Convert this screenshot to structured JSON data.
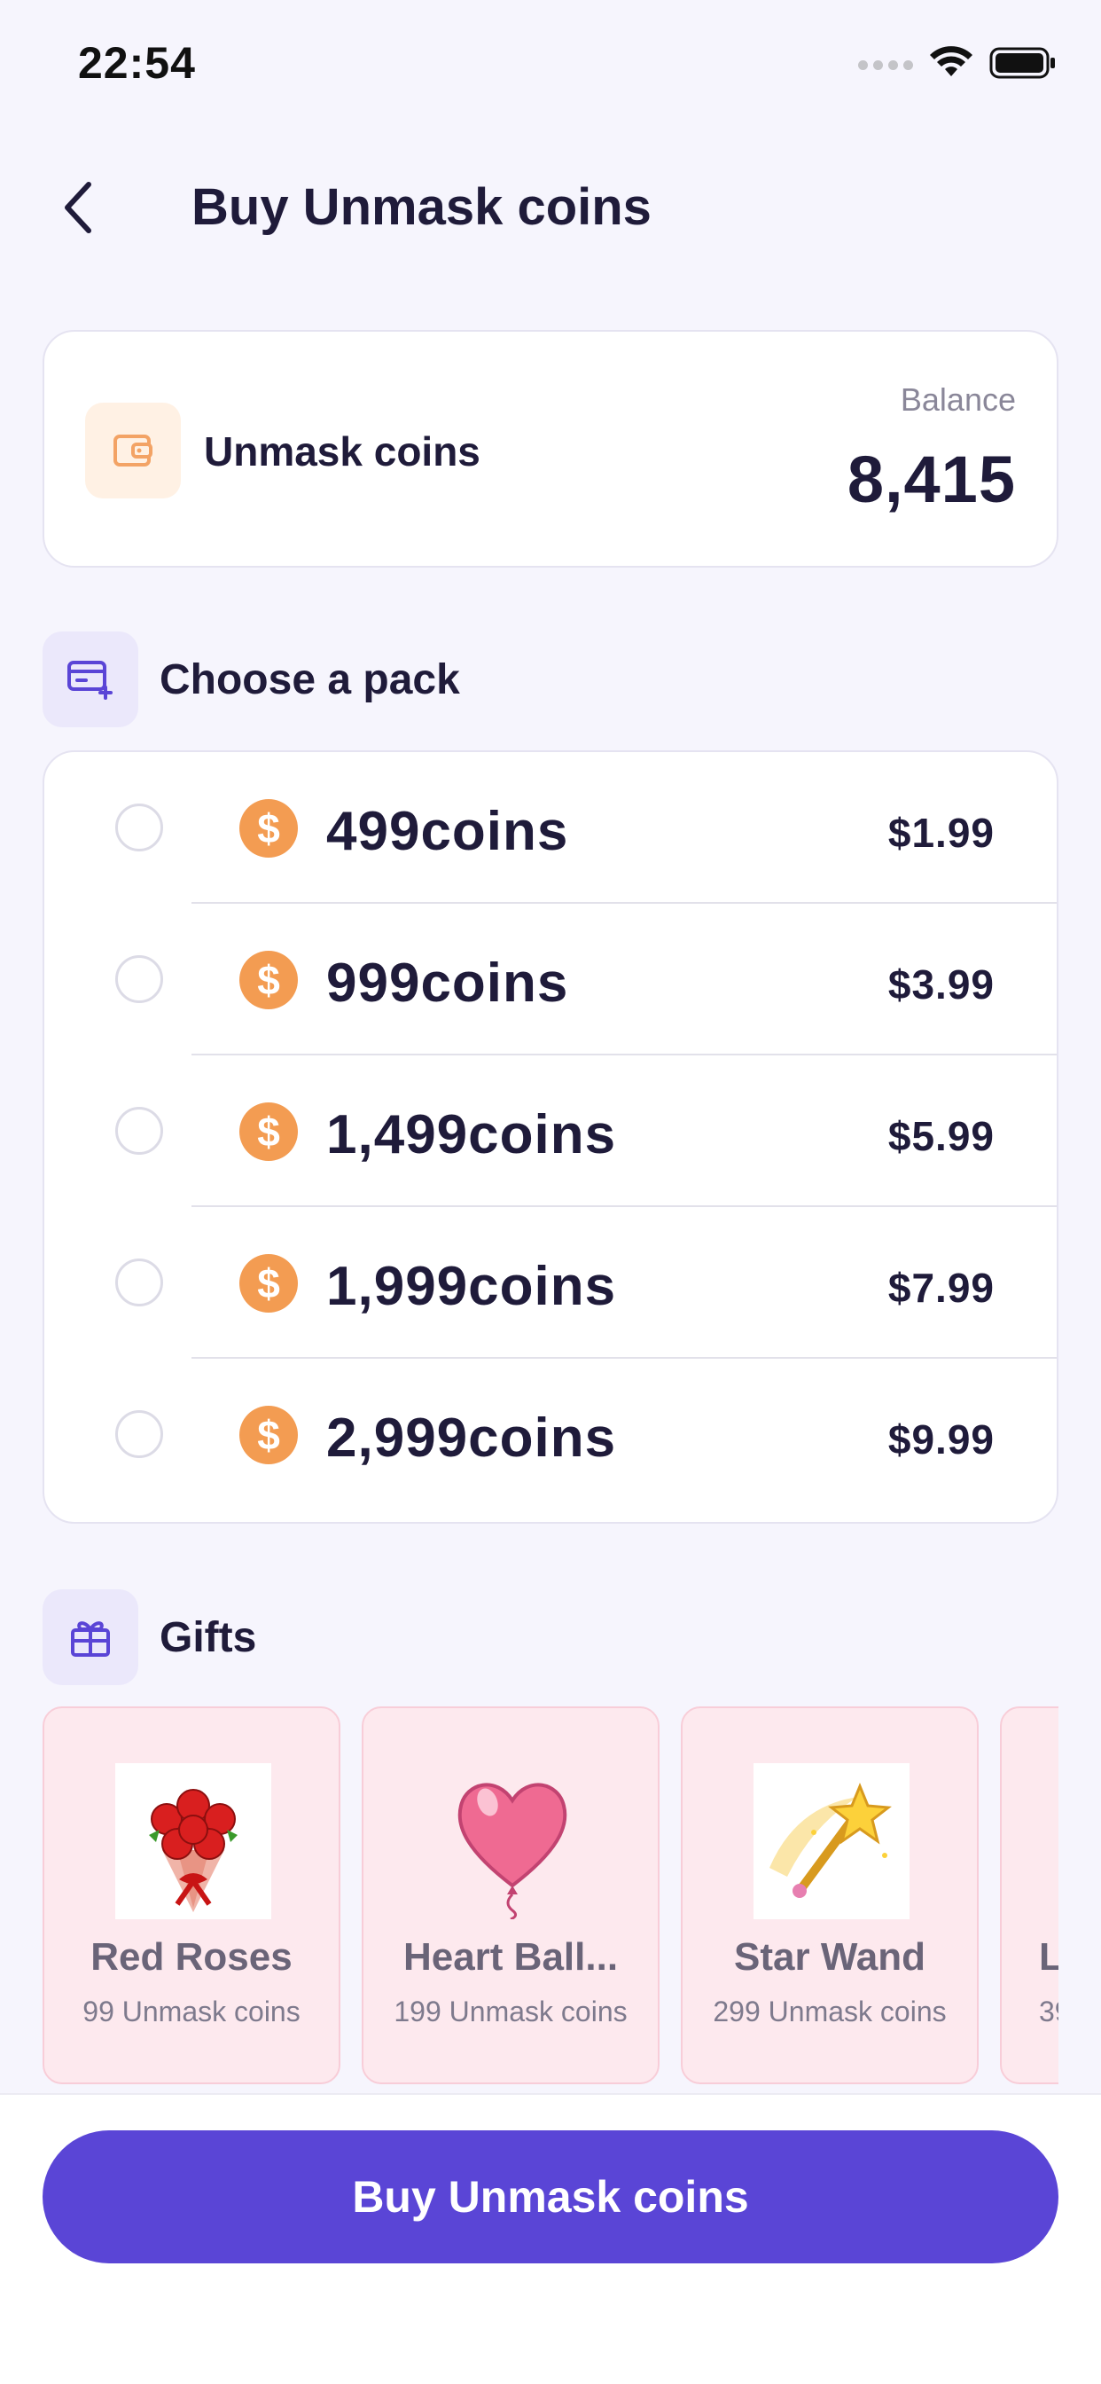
{
  "status_bar": {
    "time": "22:54"
  },
  "header": {
    "title": "Buy Unmask coins"
  },
  "balance": {
    "name": "Unmask coins",
    "label": "Balance",
    "value": "8,415"
  },
  "packs_section": {
    "title": "Choose a pack"
  },
  "packs": [
    {
      "amount": "499coins",
      "price": "$1.99"
    },
    {
      "amount": "999coins",
      "price": "$3.99"
    },
    {
      "amount": "1,499coins",
      "price": "$5.99"
    },
    {
      "amount": "1,999coins",
      "price": "$7.99"
    },
    {
      "amount": "2,999coins",
      "price": "$9.99"
    }
  ],
  "coin_symbol": "$",
  "gifts_section": {
    "title": "Gifts"
  },
  "gifts": [
    {
      "name": "Red Roses",
      "price": "99 Unmask coins",
      "icon": "roses-bouquet"
    },
    {
      "name": "Heart Ball...",
      "price": "199 Unmask coins",
      "icon": "heart-balloon"
    },
    {
      "name": "Star Wand",
      "price": "299 Unmask coins",
      "icon": "star-wand"
    },
    {
      "name": "L",
      "price": "39",
      "icon": "unknown"
    }
  ],
  "buy_button": {
    "label": "Buy Unmask coins"
  },
  "colors": {
    "accent": "#5a45d6",
    "coin": "#f39c52",
    "gift_card_bg": "#fde9ee",
    "background": "#f6f5fd"
  }
}
